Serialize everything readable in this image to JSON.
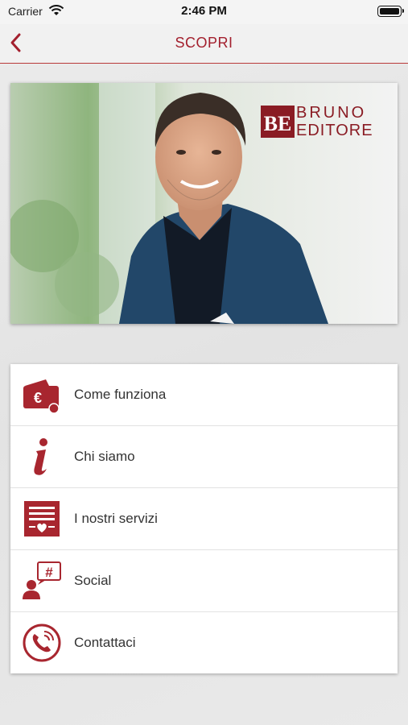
{
  "status_bar": {
    "carrier": "Carrier",
    "time": "2:46 PM"
  },
  "nav": {
    "title": "SCOPRI",
    "back_icon": "chevron-left-icon"
  },
  "hero": {
    "logo_line1": "BRUNO",
    "logo_line2": "EDITORE",
    "logo_mark": "BE"
  },
  "menu": {
    "items": [
      {
        "label": "Come funziona",
        "icon": "wallet-euro-icon"
      },
      {
        "label": "Chi siamo",
        "icon": "info-icon"
      },
      {
        "label": "I nostri servizi",
        "icon": "services-list-icon"
      },
      {
        "label": "Social",
        "icon": "social-hashtag-icon"
      },
      {
        "label": "Contattaci",
        "icon": "phone-icon"
      }
    ]
  },
  "colors": {
    "accent": "#a3202e",
    "icon": "#a8262f"
  }
}
